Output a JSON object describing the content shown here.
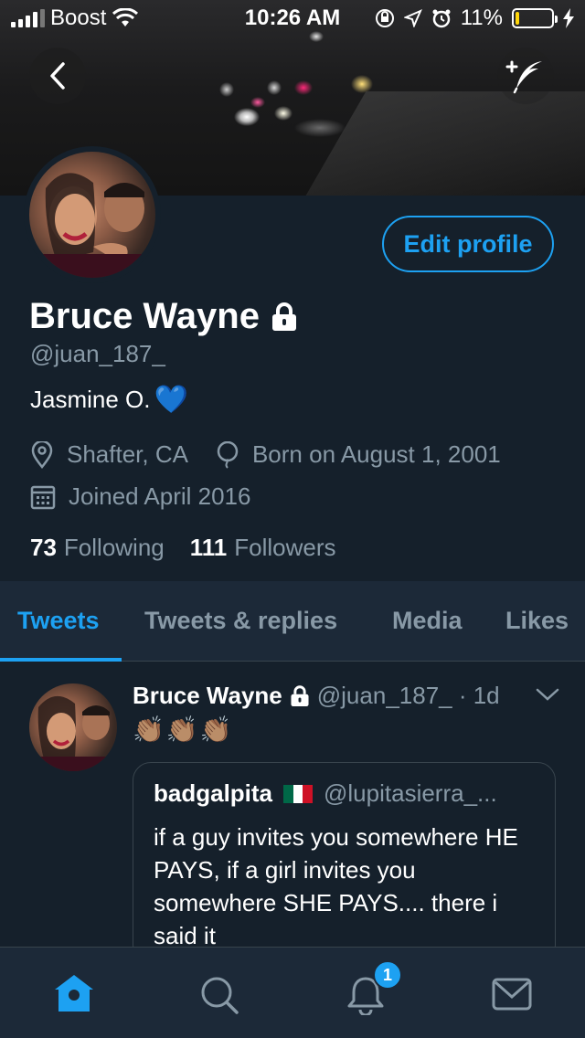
{
  "status_bar": {
    "carrier": "Boost",
    "time": "10:26 AM",
    "battery_percent": "11%",
    "battery_level": 0.11
  },
  "header": {
    "back_icon": "chevron-left-icon",
    "compose_icon": "compose-tweet-icon"
  },
  "profile": {
    "edit_button": "Edit profile",
    "name": "Bruce Wayne",
    "handle": "@juan_187_",
    "bio": "Jasmine O.",
    "bio_emoji": "💙",
    "location": "Shafter, CA",
    "birthday": "Born on August 1, 2001",
    "joined": "Joined April 2016",
    "following_count": "73",
    "following_label": "Following",
    "followers_count": "111",
    "followers_label": "Followers"
  },
  "tabs": [
    {
      "label": "Tweets",
      "active": true
    },
    {
      "label": "Tweets & replies",
      "active": false
    },
    {
      "label": "Media",
      "active": false
    },
    {
      "label": "Likes",
      "active": false
    }
  ],
  "tweet": {
    "name": "Bruce Wayne",
    "handle_time": "@juan_187_ · 1d",
    "content": "👏🏽👏🏽👏🏽",
    "quote": {
      "name": "badgalpita",
      "handle": "@lupitasierra_...",
      "text": "if a guy invites you somewhere HE PAYS, if a girl invites you somewhere SHE PAYS.... there i said it"
    }
  },
  "bottom_nav": {
    "notifications_badge": "1",
    "items": [
      "home-icon",
      "search-icon",
      "notifications-icon",
      "messages-icon"
    ]
  },
  "colors": {
    "background": "#15202b",
    "accent": "#1da1f2",
    "secondary_text": "#8899a6"
  }
}
